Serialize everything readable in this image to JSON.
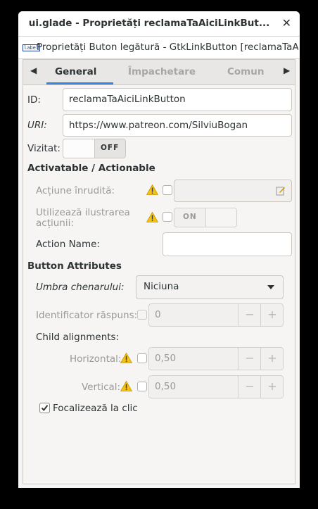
{
  "window": {
    "title": "ui.glade - Proprietăți reclamaTaAiciLinkBut...",
    "subtitle_icon_text": "label",
    "subtitle": "Proprietăți Buton legătură - GtkLinkButton [reclamaTaA..."
  },
  "tabs": [
    {
      "label": "General",
      "active": true
    },
    {
      "label": "Împachetare",
      "active": false
    },
    {
      "label": "Comun",
      "active": false
    }
  ],
  "fields": {
    "id_label": "ID:",
    "id_value": "reclamaTaAiciLinkButton",
    "uri_label": "URI:",
    "uri_value": "https://www.patreon.com/SilviuBogan",
    "visited_label": "Vizitat:",
    "visited_state": "OFF"
  },
  "actionable": {
    "heading": "Activatable / Actionable",
    "related_action_label": "Acțiune înrudită:",
    "use_action_appearance_label_1": "Utilizează ilustrarea",
    "use_action_appearance_label_2": "acțiunii:",
    "use_action_appearance_state": "ON",
    "action_name_label": "Action Name:",
    "action_name_value": ""
  },
  "button_attributes": {
    "heading": "Button Attributes",
    "relief_label": "Umbra chenarului:",
    "relief_value": "Niciuna",
    "response_id_label": "Identificator răspuns:",
    "response_id_value": "0",
    "child_alignments_label": "Child alignments:",
    "horizontal_label": "Horizontal:",
    "horizontal_value": "0,50",
    "vertical_label": "Vertical:",
    "vertical_value": "0,50",
    "focus_on_click_label": "Focalizează la clic",
    "focus_on_click_checked": true
  },
  "icons": {
    "minus": "−",
    "plus": "+",
    "close": "✕"
  },
  "colors": {
    "accent": "#3584e4",
    "warning": "#f5c211"
  }
}
